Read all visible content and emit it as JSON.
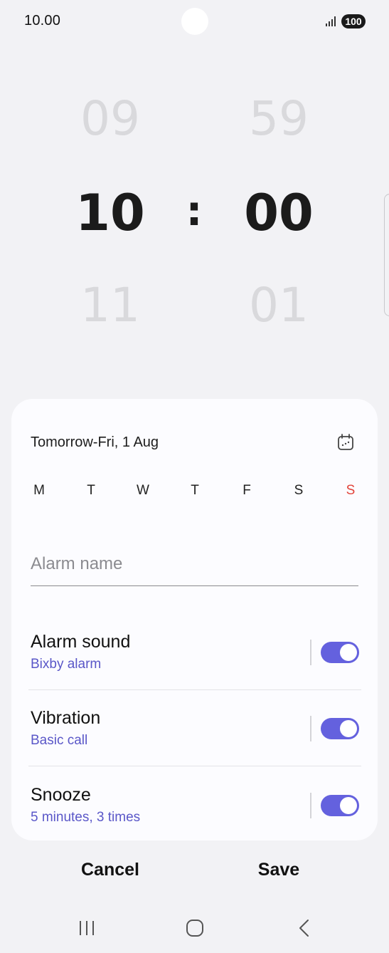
{
  "status_bar": {
    "time": "10.00",
    "battery": "100",
    "icons": [
      "signal-icon",
      "battery-icon"
    ]
  },
  "time_picker": {
    "hour_prev": "09",
    "hour": "10",
    "hour_next": "11",
    "separator": ":",
    "minute_prev": "59",
    "minute": "00",
    "minute_next": "01"
  },
  "alarm": {
    "date_label": "Tomorrow-Fri, 1 Aug",
    "calendar_icon": "calendar-icon",
    "days": [
      "M",
      "T",
      "W",
      "T",
      "F",
      "S",
      "S"
    ],
    "name_placeholder": "Alarm name",
    "name_value": ""
  },
  "settings": [
    {
      "title": "Alarm sound",
      "subtitle": "Bixby alarm",
      "enabled": true
    },
    {
      "title": "Vibration",
      "subtitle": "Basic call",
      "enabled": true
    },
    {
      "title": "Snooze",
      "subtitle": "5 minutes, 3 times",
      "enabled": true
    }
  ],
  "actions": {
    "cancel": "Cancel",
    "save": "Save"
  },
  "nav_bar": {
    "icons": [
      "recents-icon",
      "home-icon",
      "back-icon"
    ]
  },
  "colors": {
    "accent": "#6461de",
    "sunday": "#e2453c",
    "background": "#f2f2f5",
    "card": "#fcfcff"
  }
}
